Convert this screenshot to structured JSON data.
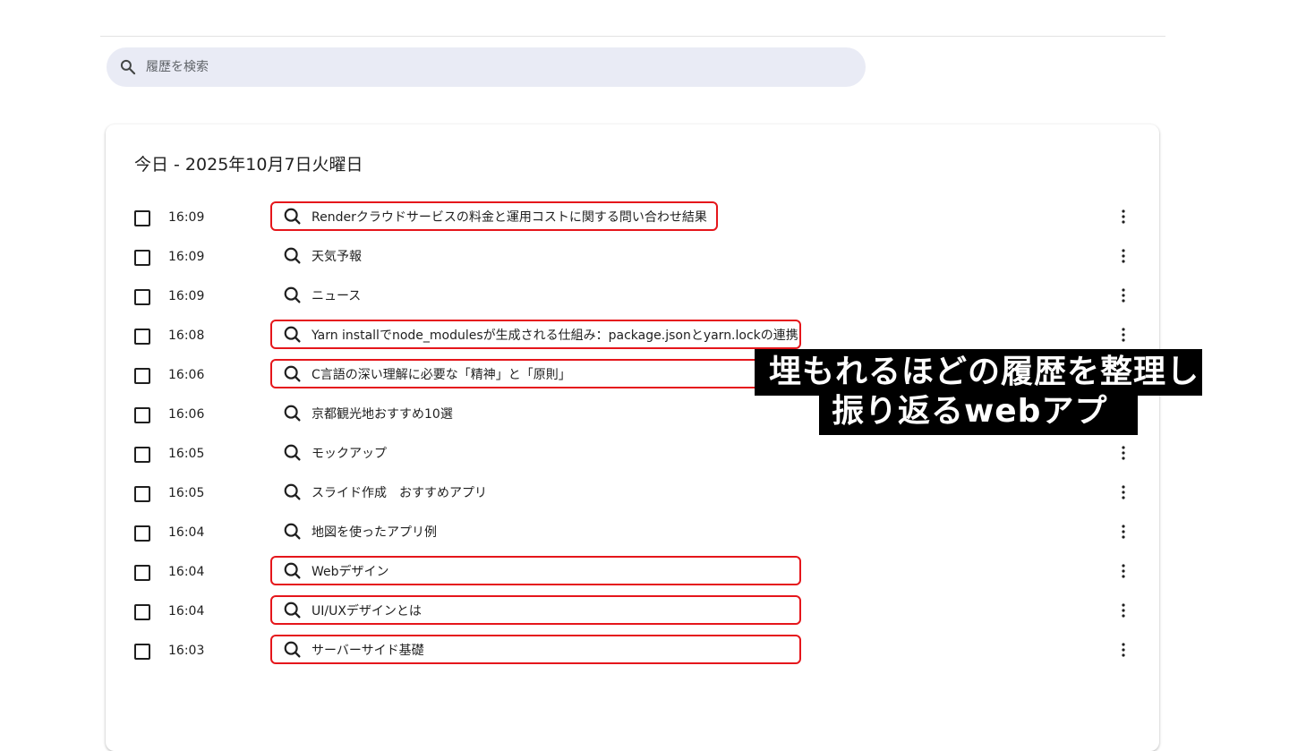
{
  "search": {
    "placeholder": "履歴を検索",
    "icon": "search-icon"
  },
  "day_group": {
    "date_label": "今日 - 2025年10月7日火曜日",
    "entries": [
      {
        "time": "16:09",
        "title": "Renderクラウドサービスの料金と運用コストに関する問い合わせ結果",
        "highlighted": true
      },
      {
        "time": "16:09",
        "title": "天気予報",
        "highlighted": false
      },
      {
        "time": "16:09",
        "title": "ニュース",
        "highlighted": false
      },
      {
        "time": "16:08",
        "title": "Yarn installでnode_modulesが生成される仕組み：package.jsonとyarn.lockの連携",
        "highlighted": true
      },
      {
        "time": "16:06",
        "title": "C言語の深い理解に必要な「精神」と「原則」",
        "highlighted": true
      },
      {
        "time": "16:06",
        "title": "京都観光地おすすめ10選",
        "highlighted": false
      },
      {
        "time": "16:05",
        "title": "モックアップ",
        "highlighted": false
      },
      {
        "time": "16:05",
        "title": "スライド作成　おすすめアプリ",
        "highlighted": false
      },
      {
        "time": "16:04",
        "title": "地図を使ったアプリ例",
        "highlighted": false
      },
      {
        "time": "16:04",
        "title": "Webデザイン",
        "highlighted": true
      },
      {
        "time": "16:04",
        "title": "UI/UXデザインとは",
        "highlighted": true
      },
      {
        "time": "16:03",
        "title": "サーバーサイド基礎",
        "highlighted": true
      }
    ]
  },
  "overlay": {
    "line1": "埋もれるほどの履歴を整理し",
    "line2": "振り返るwebアプリ"
  },
  "colors": {
    "highlight": "#e5161b",
    "search_bg": "#e9ebf5"
  }
}
